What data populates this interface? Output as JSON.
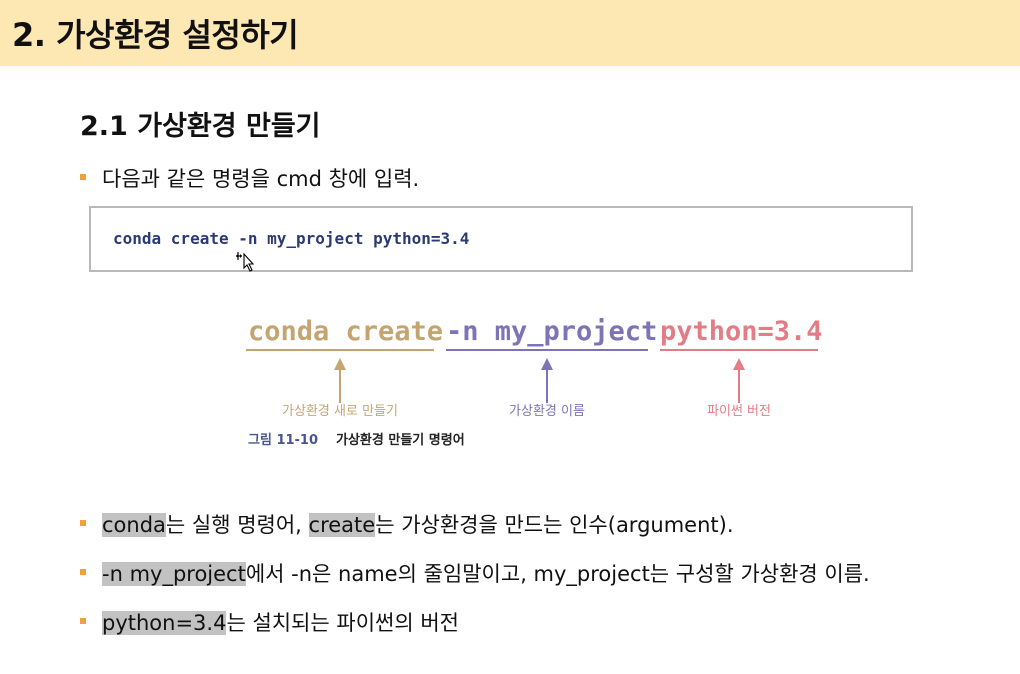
{
  "header": {
    "title": "2. 가상환경 설정하기",
    "background": "#fde8b4"
  },
  "section": {
    "title": "2.1 가상환경 만들기"
  },
  "intro": "다음과 같은 명령을 cmd 창에 입력.",
  "code_box": {
    "command": "conda create -n my_project python=3.4"
  },
  "figure": {
    "parts": [
      {
        "text": "conda create",
        "label": "가상환경 새로 만들기",
        "color": "#c4a572"
      },
      {
        "text": "-n my_project",
        "label": "가상환경 이름",
        "color": "#7d74b5"
      },
      {
        "text": "python=3.4",
        "label": "파이썬 버전",
        "color": "#e27d86"
      }
    ],
    "caption_number": "그림 11-10",
    "caption_text": "가상환경 만들기 명령어"
  },
  "bullets": [
    {
      "hl1": "conda",
      "t1": "는 실행 명령어, ",
      "hl2": "create",
      "t2": "는 가상환경을 만드는 인수(argument)."
    },
    {
      "hl1": "-n my_project",
      "t1": "에서 -n은 name의 줄임말이고, my_project는 구성할 가상환경 이름."
    },
    {
      "hl1": "python=3.4",
      "t1": "는 설치되는 파이썬의 버전"
    }
  ],
  "colors": {
    "bullet": "#f2a13a",
    "highlight": "#c2c2c2",
    "code_text": "#2b3a75"
  }
}
